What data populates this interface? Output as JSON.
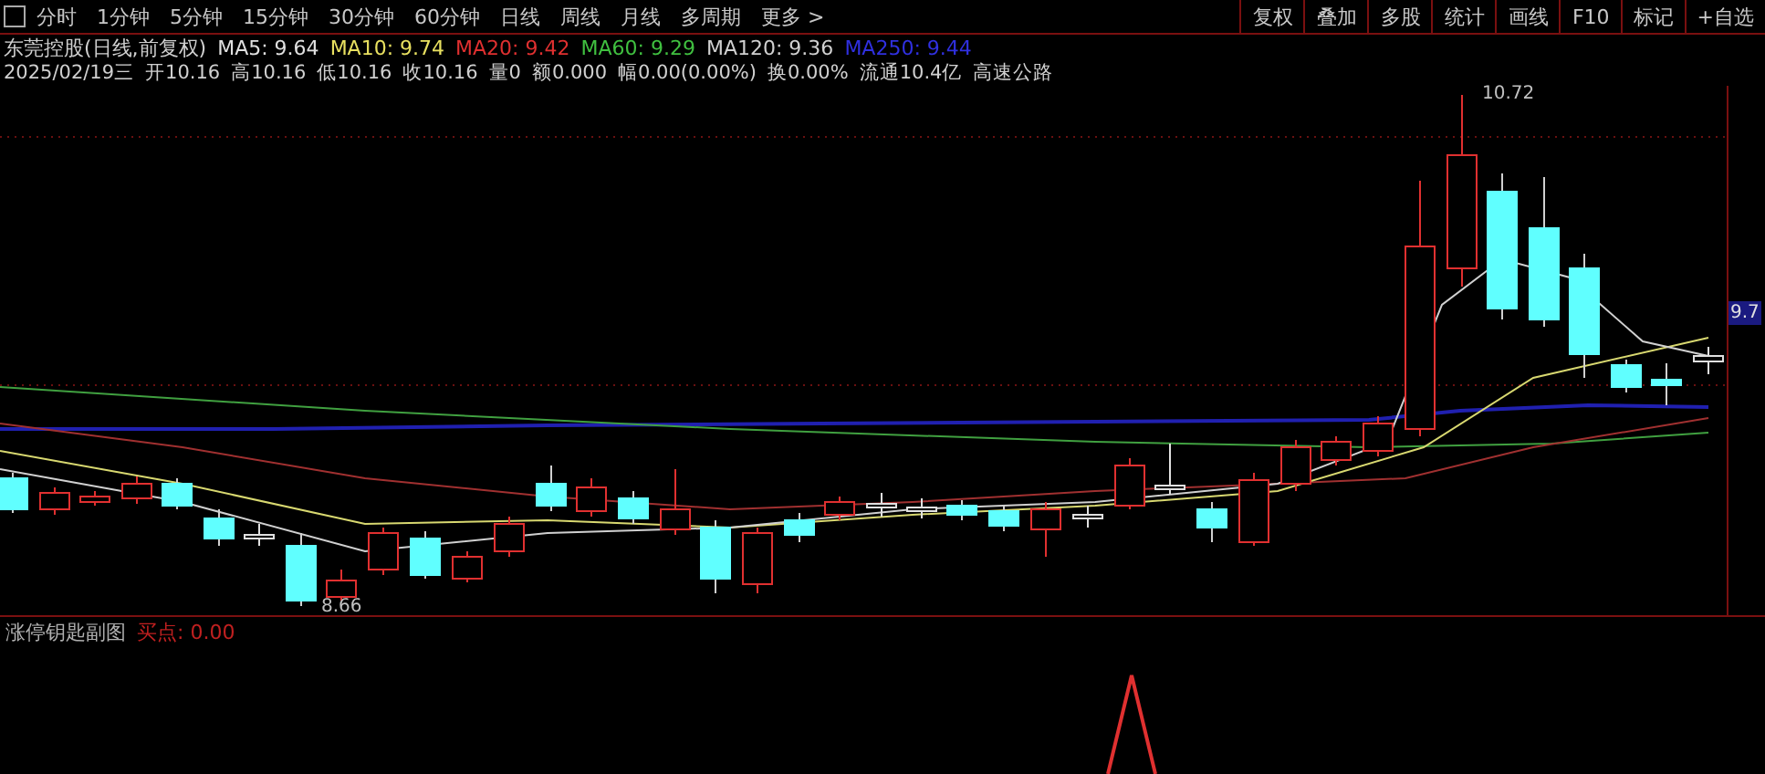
{
  "toolbar": {
    "periods": [
      "分时",
      "1分钟",
      "5分钟",
      "15分钟",
      "30分钟",
      "60分钟",
      "日线",
      "周线",
      "月线",
      "多周期",
      "更多 >"
    ],
    "actions": [
      "复权",
      "叠加",
      "多股",
      "统计",
      "画线",
      "F10",
      "标记",
      "+自选"
    ]
  },
  "chart": {
    "title": "东莞控股(日线,前复权)",
    "moving_averages": [
      {
        "label": "MA5: 9.64",
        "color": "#e0e0e0"
      },
      {
        "label": "MA10: 9.74",
        "color": "#e8e060"
      },
      {
        "label": "MA20: 9.42",
        "color": "#e03030"
      },
      {
        "label": "MA60: 9.29",
        "color": "#40c040"
      },
      {
        "label": "MA120: 9.36",
        "color": "#d0d0d0"
      },
      {
        "label": "MA250: 9.44",
        "color": "#3030e0"
      }
    ],
    "quote": [
      "2025/02/19三",
      "开10.16",
      "高10.16",
      "低10.16",
      "收10.16",
      "量0",
      "额0.000",
      "幅0.00(0.00%)",
      "换0.00%",
      "流通10.4亿",
      "高速公路"
    ],
    "high_label": "10.72",
    "low_label": "8.66",
    "axis_tag": "9.7"
  },
  "indicator": {
    "name": "涨停钥匙副图",
    "reading": "买点: 0.00"
  }
}
